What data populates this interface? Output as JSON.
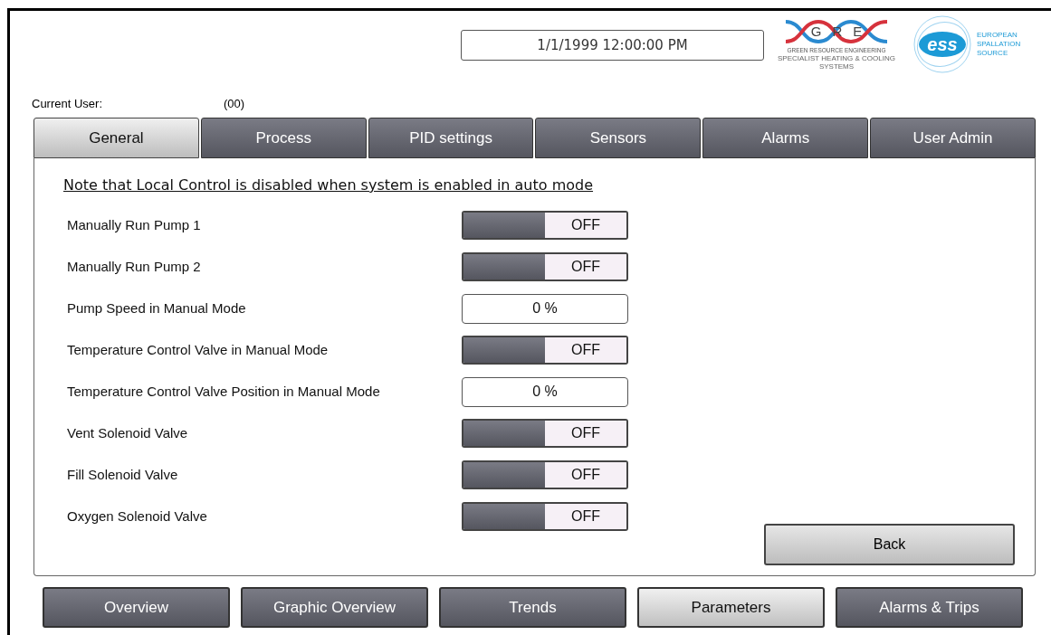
{
  "datetime": "1/1/1999 12:00:00 PM",
  "grex_logo": {
    "letters": [
      "G",
      "R",
      "E"
    ],
    "name": "GREEN RESOURCE ENGINEERING",
    "tagline": "SPECIALIST HEATING & COOLING SYSTEMS"
  },
  "ess_logo": {
    "mark": "ess",
    "lines": [
      "EUROPEAN",
      "SPALLATION",
      "SOURCE"
    ]
  },
  "current_user": {
    "label": "Current User:",
    "value": "(00)"
  },
  "tabs": [
    {
      "label": "General",
      "selected": true
    },
    {
      "label": "Process",
      "selected": false
    },
    {
      "label": "PID settings",
      "selected": false
    },
    {
      "label": "Sensors",
      "selected": false
    },
    {
      "label": "Alarms",
      "selected": false
    },
    {
      "label": "User Admin",
      "selected": false
    }
  ],
  "note": "Note that Local Control is disabled when system is enabled in auto mode",
  "settings": [
    {
      "kind": "toggle",
      "label": "Manually Run Pump 1",
      "on": false,
      "value": "OFF"
    },
    {
      "kind": "toggle",
      "label": "Manually Run Pump 2",
      "on": false,
      "value": "OFF"
    },
    {
      "kind": "field",
      "label": "Pump Speed in Manual Mode",
      "value": "0 %"
    },
    {
      "kind": "toggle",
      "label": "Temperature Control Valve in Manual Mode",
      "on": false,
      "value": "OFF"
    },
    {
      "kind": "field",
      "label": "Temperature Control Valve Position in Manual Mode",
      "value": "0 %"
    },
    {
      "kind": "toggle",
      "label": "Vent Solenoid Valve",
      "on": false,
      "value": "OFF"
    },
    {
      "kind": "toggle",
      "label": "Fill Solenoid Valve",
      "on": false,
      "value": "OFF"
    },
    {
      "kind": "toggle",
      "label": "Oxygen Solenoid Valve",
      "on": false,
      "value": "OFF"
    }
  ],
  "back_button": "Back",
  "nav": [
    {
      "label": "Overview",
      "selected": false
    },
    {
      "label": "Graphic Overview",
      "selected": false
    },
    {
      "label": "Trends",
      "selected": false
    },
    {
      "label": "Parameters",
      "selected": true
    },
    {
      "label": "Alarms & Trips",
      "selected": false
    }
  ]
}
